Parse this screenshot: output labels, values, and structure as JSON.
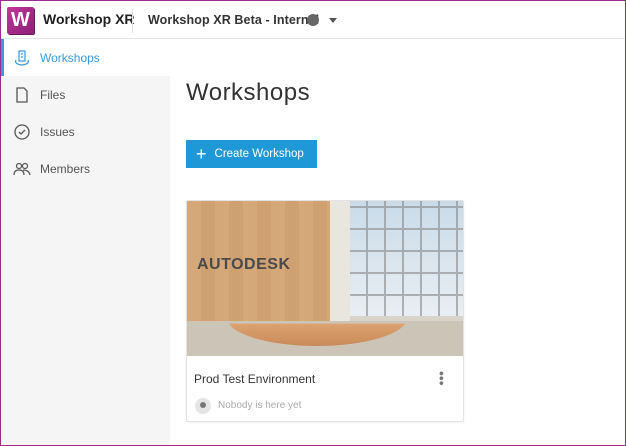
{
  "header": {
    "logo_letter": "W",
    "app_name": "Workshop XR",
    "project": "Workshop XR Beta - Internal"
  },
  "sidebar": {
    "items": [
      {
        "label": "Workshops",
        "active": true
      },
      {
        "label": "Files"
      },
      {
        "label": "Issues"
      },
      {
        "label": "Members"
      }
    ]
  },
  "main": {
    "title": "Workshops",
    "create_label": "Create Workshop",
    "cards": [
      {
        "name": "Prod Test Environment",
        "status": "Nobody is here yet",
        "thumb_text": "AUTODESK"
      }
    ]
  },
  "colors": {
    "accent": "#1f98d8",
    "brand": "#a8288a"
  }
}
